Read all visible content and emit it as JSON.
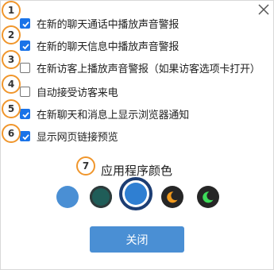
{
  "dialog": {
    "close_icon": "close-icon",
    "options": [
      {
        "marker": "1",
        "label": "在新的聊天通话中播放声音警报",
        "checked": true
      },
      {
        "marker": "2",
        "label": "在新的聊天信息中播放声音警报",
        "checked": true
      },
      {
        "marker": "3",
        "label": "在新访客上播放声音警报（如果访客选项卡打开）",
        "checked": false
      },
      {
        "marker": "4",
        "label": "自动接受访客来电",
        "checked": false
      },
      {
        "marker": "5",
        "label": "在新聊天和消息上显示浏览器通知",
        "checked": true
      },
      {
        "marker": "6",
        "label": "显示网页链接预览",
        "checked": true
      }
    ],
    "color_section": {
      "marker": "7",
      "title": "应用程序颜色",
      "swatches": [
        {
          "name": "light-blue",
          "color": "#4a8fd4",
          "selected": false
        },
        {
          "name": "teal",
          "color": "#1f5d58",
          "selected": false
        },
        {
          "name": "blue",
          "color": "#2f7fd2",
          "selected": true
        },
        {
          "name": "dark-orange",
          "color": "#262626",
          "accent": "#f29a1c",
          "icon": "moon-icon",
          "selected": false
        },
        {
          "name": "dark-green",
          "color": "#262626",
          "accent": "#3ddc5a",
          "icon": "moon-icon",
          "selected": false
        }
      ]
    },
    "close_button_label": "关闭"
  },
  "colors": {
    "checkbox_checked": "#1a73e8",
    "marker_border": "#f0962c",
    "button_bg": "#4a8fd4",
    "selected_ring": "#1c3d73"
  }
}
